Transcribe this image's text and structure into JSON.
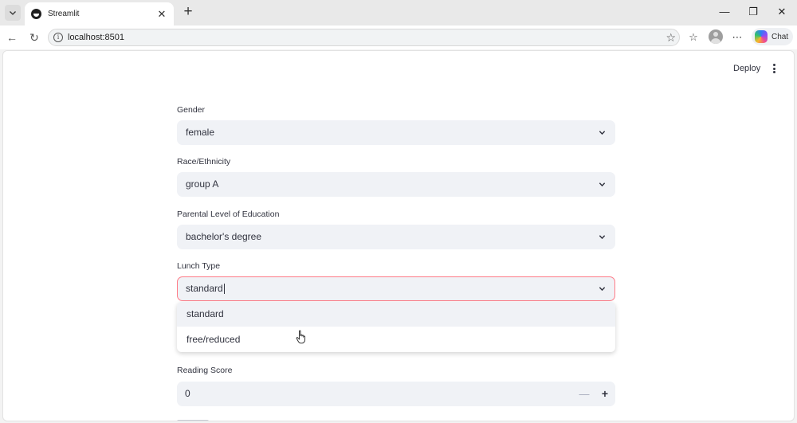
{
  "browser": {
    "tab_title": "Streamlit",
    "url": "localhost:8501",
    "chat_label": "Chat"
  },
  "app": {
    "deploy_label": "Deploy",
    "fields": [
      {
        "label": "Gender",
        "value": "female"
      },
      {
        "label": "Race/Ethnicity",
        "value": "group A"
      },
      {
        "label": "Parental Level of Education",
        "value": "bachelor's degree"
      },
      {
        "label": "Lunch Type",
        "value": "standard"
      }
    ],
    "lunch_options": [
      "standard",
      "free/reduced"
    ],
    "reading_score": {
      "label": "Reading Score",
      "value": "0"
    },
    "accent_color": "#ff4b4b"
  }
}
